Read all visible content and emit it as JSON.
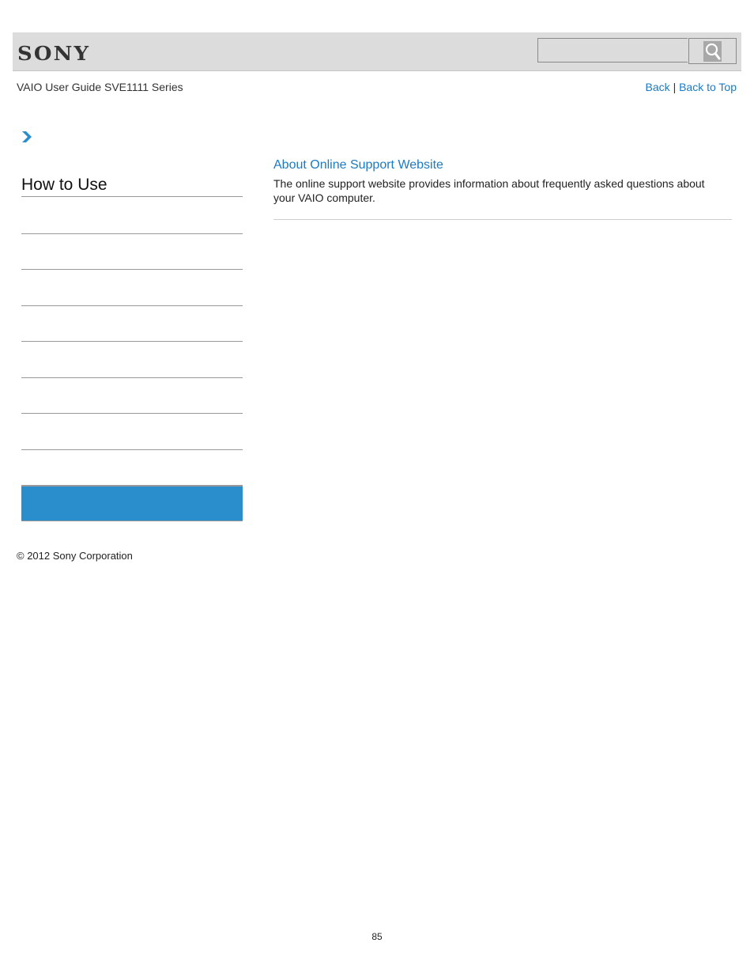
{
  "header": {
    "logo": "SONY",
    "search": {
      "value": "",
      "placeholder": ""
    },
    "search_icon": "magnifier-icon"
  },
  "subheader": {
    "guide_title": "VAIO User Guide SVE1111 Series",
    "back_label": "Back",
    "separator": "|",
    "back_to_top_label": "Back to Top"
  },
  "sidebar": {
    "breadcrumb_icon": "chevron-right-icon",
    "title": "How to Use",
    "items": [
      "",
      "",
      "",
      "",
      "",
      "",
      "",
      ""
    ],
    "active_color": "#2a8dcc"
  },
  "main": {
    "article": {
      "title": "About Online Support Website",
      "body": "The online support website provides information about frequently asked questions about your VAIO computer."
    }
  },
  "footer": {
    "copyright": "© 2012 Sony Corporation",
    "page_number": "85"
  },
  "colors": {
    "link": "#1a7bc4",
    "header_bg": "#dcdcdc"
  }
}
